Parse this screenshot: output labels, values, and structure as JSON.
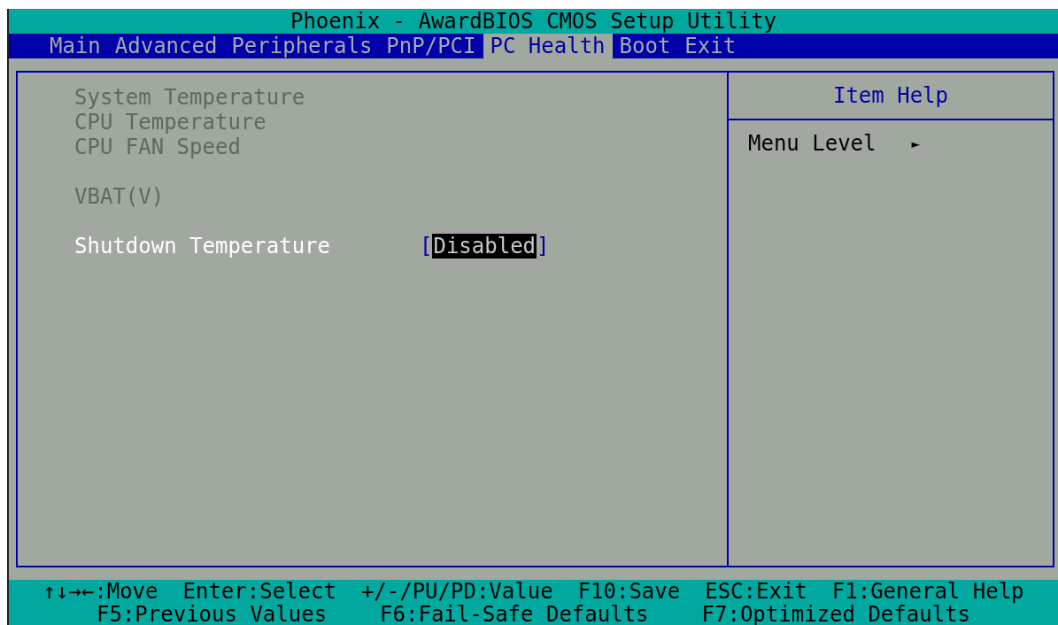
{
  "window": {
    "title": "Phoenix - AwardBIOS CMOS Setup Utility"
  },
  "tabs": [
    {
      "label": "Main",
      "selected": false
    },
    {
      "label": "Advanced",
      "selected": false
    },
    {
      "label": "Peripherals",
      "selected": false
    },
    {
      "label": "PnP/PCI",
      "selected": false
    },
    {
      "label": "PC Health",
      "selected": true
    },
    {
      "label": "Boot",
      "selected": false
    },
    {
      "label": "Exit",
      "selected": false
    }
  ],
  "setting_groups": [
    [
      {
        "label": "System Temperature",
        "disabled": true
      },
      {
        "label": "CPU Temperature",
        "disabled": true
      },
      {
        "label": "CPU FAN Speed",
        "disabled": true
      }
    ],
    [
      {
        "label": "VBAT(V)",
        "disabled": true
      }
    ],
    [
      {
        "label": "Shutdown Temperature",
        "disabled": false,
        "value_open": "[",
        "value": "Disabled",
        "value_close": "]",
        "selected": true
      }
    ]
  ],
  "item_help": {
    "title": "Item Help",
    "menu_level_label": "Menu Level",
    "menu_level_marker": "►"
  },
  "footer": {
    "lines": [
      [
        "↑↓→←:Move",
        "Enter:Select",
        "+/-/PU/PD:Value",
        "F10:Save",
        "ESC:Exit",
        "F1:General Help"
      ],
      [
        "F5:Previous Values",
        "F6:Fail-Safe Defaults",
        "F7:Optimized Defaults"
      ]
    ]
  }
}
